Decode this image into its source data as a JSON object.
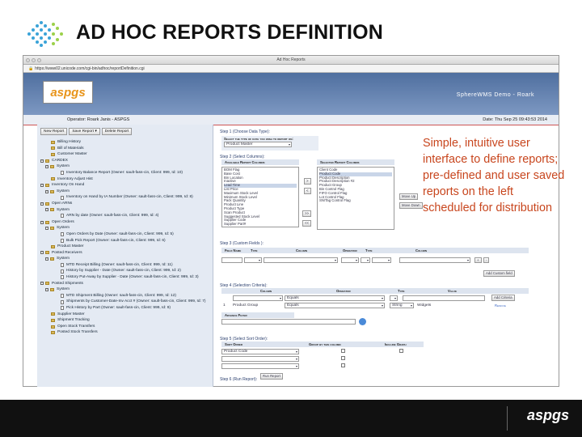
{
  "slide": {
    "title": "AD HOC REPORTS DEFINITION",
    "callout": "Simple, intuitive user interface to define reports; pre-defined and user saved reports on the left scheduled for distribution",
    "footer_logo": "aspgs"
  },
  "browser": {
    "window_title": "Ad Hoc Reports",
    "url": "https://www02.unicode.com/cgi-bin/adhoc/reportDefinition.cgi"
  },
  "app": {
    "logo": "aspgs",
    "company": "SphereWMS Demo - Roark",
    "operator": "Operator: Roark Janis - ASPGS",
    "date": "Date: Thu Sep 25 09:43:53 2014"
  },
  "toolbar": {
    "new_report": "New Report",
    "save_report": "Save Report ▾",
    "delete_report": "Delete Report"
  },
  "tree": [
    {
      "label": "Billing History",
      "level": 1,
      "kind": "folder"
    },
    {
      "label": "Bill of Materials",
      "level": 1,
      "kind": "folder"
    },
    {
      "label": "Customer Master",
      "level": 1,
      "kind": "folder"
    },
    {
      "label": "CARDEX",
      "level": 0,
      "kind": "folder",
      "toggle": "−"
    },
    {
      "label": "System",
      "level": 1,
      "kind": "folder",
      "toggle": "−"
    },
    {
      "label": "Inventory Balance Report (Owner: sault-fass-cin, Client: 999, Id: 10)",
      "level": 3,
      "kind": "doc"
    },
    {
      "label": "Inventory Adjust Hist",
      "level": 1,
      "kind": "folder"
    },
    {
      "label": "Inventory On Hand",
      "level": 0,
      "kind": "folder",
      "toggle": "−"
    },
    {
      "label": "System",
      "level": 1,
      "kind": "folder",
      "toggle": "−"
    },
    {
      "label": "Inventory on Hand by IA Number (Owner: sault-fass-cin, Client: 999, Id: 8)",
      "level": 3,
      "kind": "doc"
    },
    {
      "label": "Open ARNs",
      "level": 0,
      "kind": "folder",
      "toggle": "−"
    },
    {
      "label": "System",
      "level": 1,
      "kind": "folder",
      "toggle": "−"
    },
    {
      "label": "ARN by date (Owner: sault-fass-cin, Client: 999, Id: 4)",
      "level": 3,
      "kind": "doc"
    },
    {
      "label": "Open Orders",
      "level": 0,
      "kind": "folder",
      "toggle": "−"
    },
    {
      "label": "System",
      "level": 1,
      "kind": "folder",
      "toggle": "−"
    },
    {
      "label": "Open Orders by Date (Owner: sault-fass-cin, Client: 999, Id: 5)",
      "level": 3,
      "kind": "doc"
    },
    {
      "label": "Bulk Pick Report (Owner: sault-fass-cin, Client: 999, Id: 6)",
      "level": 3,
      "kind": "doc"
    },
    {
      "label": "Product Master",
      "level": 1,
      "kind": "folder"
    },
    {
      "label": "Posted Receivers",
      "level": 0,
      "kind": "folder",
      "toggle": "−"
    },
    {
      "label": "System",
      "level": 1,
      "kind": "folder",
      "toggle": "−"
    },
    {
      "label": "MTD Receipt Billing (Owner: sault-fass-cin, Client: 999, Id: 11)",
      "level": 3,
      "kind": "doc"
    },
    {
      "label": "History by Supplier - Date (Owner: sault-fass-cin, Client: 999, Id: 2)",
      "level": 3,
      "kind": "doc"
    },
    {
      "label": "History Put-Away by Supplier - Date (Owner: sault-fass-cin, Client: 999, Id: 3)",
      "level": 3,
      "kind": "doc"
    },
    {
      "label": "Posted Shipments",
      "level": 0,
      "kind": "folder",
      "toggle": "−"
    },
    {
      "label": "System",
      "level": 1,
      "kind": "folder",
      "toggle": "−"
    },
    {
      "label": "MTD Shipment Billing (Owner: sault-fass-cin, Client: 999, Id: 12)",
      "level": 3,
      "kind": "doc"
    },
    {
      "label": "Shipments by Customer-Date-Inv Acct # (Owner: sault-fass-cin, Client: 999, Id: 7)",
      "level": 3,
      "kind": "doc"
    },
    {
      "label": "Pick History by Part (Owner: sault-fass-cin, Client: 999, Id: 9)",
      "level": 3,
      "kind": "doc"
    },
    {
      "label": "Supplier Master",
      "level": 1,
      "kind": "folder"
    },
    {
      "label": "Shipment Tracking",
      "level": 1,
      "kind": "folder"
    },
    {
      "label": "Open Stock Transfers",
      "level": 1,
      "kind": "folder"
    },
    {
      "label": "Posted Stock Transfers",
      "level": 1,
      "kind": "folder"
    }
  ],
  "step1": {
    "title": "Step 1 (Choose Data Type):",
    "header": "Select the type of data you wish to report on:",
    "selected": "Product Master"
  },
  "step2": {
    "title": "Step 2 (Select Columns):",
    "available_header": "Available Report Columns",
    "selected_header": "Selected Report Columns",
    "available": [
      "BOM Flag",
      "Base Cost",
      "Bin Location",
      "Inactive",
      "Lead Time",
      "List Price",
      "Maximum Stock Level",
      "Minimum Stock Level",
      "Pack Quantity",
      "Product Line",
      "Product Type",
      "Scan Product",
      "Suggested Stock Level",
      "Supplier Code",
      "Supplier Part#"
    ],
    "selected_cols": [
      "Client Code",
      "Product Code",
      "Product Description",
      "Product Description #2",
      "Product Group",
      "Bin Control Flag",
      "FIFO Control Flag",
      "Lot Control Flag",
      "SN/Tag Control Flag"
    ],
    "btn_add": ">",
    "btn_remove": "<",
    "btn_add_all": ">>",
    "btn_remove_all": "<<",
    "move_up": "Move Up",
    "move_down": "Move Down"
  },
  "step3": {
    "title": "Step 3 (Custom Fields ):",
    "col_field_name": "Field Name",
    "col_type": "Type",
    "col_column": "Column",
    "col_operator": "Operator",
    "col_type2": "Type",
    "col_column2": "Column",
    "add_button": "Add Custom field",
    "plus": "+",
    "minus": "-"
  },
  "step4": {
    "title": "Step 4 (Selection Criteria):",
    "col_column": "Column",
    "col_operator": "Operator",
    "col_type": "Type",
    "col_value": "Value",
    "op_default": "Equals",
    "add_button": "Add Criteria",
    "row_num": "1",
    "row_column": "Product Group",
    "row_operator": "Equals",
    "row_type": "String",
    "row_value": "Widgets",
    "remove": "Remove",
    "advance_filter": "Advance Filter"
  },
  "step5": {
    "title": "Step 5 (Select Sort Order):",
    "col_sort_order": "Sort Order",
    "col_group": "Group by this column",
    "col_graph": "Include Graph",
    "sort_value": "Product Code"
  },
  "step6": {
    "title": "Step 6 (Run Report):",
    "run_button": "Run Report"
  },
  "colors": {
    "accent": "#c8461e",
    "header_blue": "#4f6f9f",
    "brand_orange": "#e8941a"
  }
}
